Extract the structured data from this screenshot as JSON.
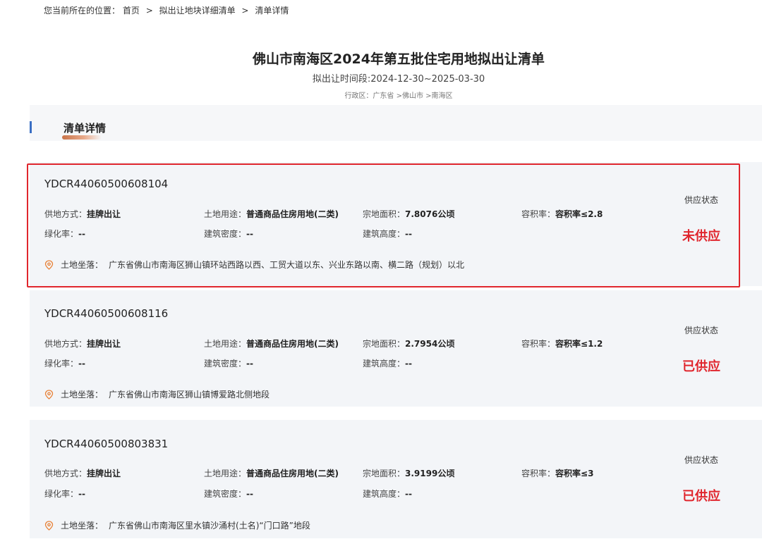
{
  "breadcrumb": {
    "prefix": "您当前所在的位置：",
    "items": [
      "首页",
      "拟出让地块详细清单",
      "清单详情"
    ],
    "separator": ">"
  },
  "page": {
    "title": "佛山市南海区2024年第五批住宅用地拟出让清单",
    "period": "拟出让时间段:2024-12-30~2025-03-30",
    "region": "行政区：广东省 >佛山市 >南海区"
  },
  "section": {
    "title": "清单详情"
  },
  "labels": {
    "supply_method": "供地方式：",
    "land_use": "土地用途：",
    "parcel_area": "宗地面积：",
    "plot_ratio": "容积率：",
    "green_ratio": "绿化率：",
    "building_density": "建筑密度：",
    "building_height": "建筑高度：",
    "location": "土地坐落：",
    "supply_status": "供应状态"
  },
  "colors": {
    "accent_red": "#e0262d",
    "section_bar": "#3a6fc4",
    "card_bg": "#f3f5f8"
  },
  "icons": {
    "location": "map-pin-icon"
  },
  "parcels": [
    {
      "code": "YDCR44060500608104",
      "supply_method": "挂牌出让",
      "land_use": "普通商品住房用地(二类)",
      "parcel_area": "7.8076公顷",
      "plot_ratio": "容积率≤2.8",
      "green_ratio": "--",
      "building_density": "--",
      "building_height": "--",
      "location": "广东省佛山市南海区狮山镇环站西路以西、工贸大道以东、兴业东路以南、横二路（规划）以北",
      "status": "未供应",
      "highlighted": true
    },
    {
      "code": "YDCR44060500608116",
      "supply_method": "挂牌出让",
      "land_use": "普通商品住房用地(二类)",
      "parcel_area": "2.7954公顷",
      "plot_ratio": "容积率≤1.2",
      "green_ratio": "--",
      "building_density": "--",
      "building_height": "--",
      "location": "广东省佛山市南海区狮山镇博爱路北侧地段",
      "status": "已供应",
      "highlighted": false
    },
    {
      "code": "YDCR44060500803831",
      "supply_method": "挂牌出让",
      "land_use": "普通商品住房用地(二类)",
      "parcel_area": "3.9199公顷",
      "plot_ratio": "容积率≤3",
      "green_ratio": "--",
      "building_density": "--",
      "building_height": "--",
      "location": "广东省佛山市南海区里水镇沙涌村(土名)“门口路”地段",
      "status": "已供应",
      "highlighted": false
    }
  ]
}
